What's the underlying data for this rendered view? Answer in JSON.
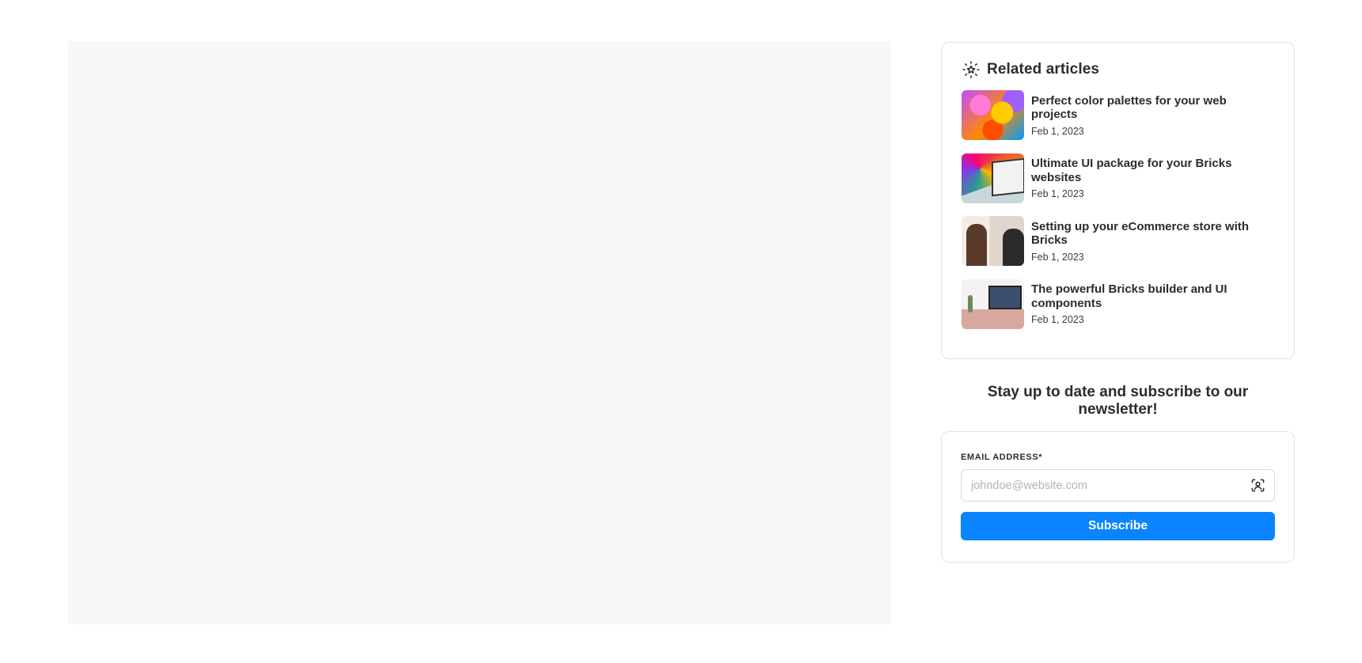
{
  "related": {
    "title": "Related articles",
    "icon": "sparkle-star-icon",
    "articles": [
      {
        "title": "Perfect color palettes for your web projects",
        "date": "Feb 1, 2023"
      },
      {
        "title": "Ultimate UI package for your Bricks websites",
        "date": "Feb 1, 2023"
      },
      {
        "title": "Setting up your eCommerce store with Bricks",
        "date": "Feb 1, 2023"
      },
      {
        "title": "The powerful Bricks builder and UI components",
        "date": "Feb 1, 2023"
      }
    ]
  },
  "newsletter": {
    "heading": "Stay up to date and subscribe to our newsletter!",
    "email_label": "EMAIL ADDRESS*",
    "email_placeholder": "johndoe@website.com",
    "email_value": "",
    "input_icon": "contact-scan-icon",
    "subscribe_label": "Subscribe",
    "accent_color": "#0a84ff"
  }
}
